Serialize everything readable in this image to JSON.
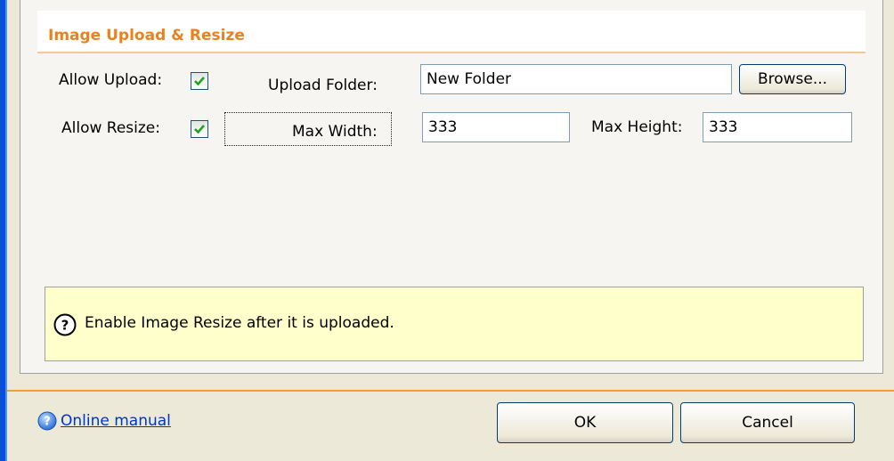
{
  "section": {
    "title": "Image Upload & Resize"
  },
  "upload": {
    "allow_label": "Allow Upload:",
    "allow_checked": true,
    "folder_label": "Upload Folder:",
    "folder_value": "New Folder",
    "browse_label": "Browse..."
  },
  "resize": {
    "allow_label": "Allow Resize:",
    "allow_checked": true,
    "max_width_label": "Max Width:",
    "max_width_value": "333",
    "max_height_label": "Max Height:",
    "max_height_value": "333"
  },
  "help": {
    "icon": "question-circle-icon",
    "text": "Enable Image Resize after it is uploaded."
  },
  "footer": {
    "manual_icon": "help-globe-icon",
    "manual_link": "Online manual",
    "ok_label": "OK",
    "cancel_label": "Cancel"
  },
  "colors": {
    "title_accent": "#e8821e",
    "help_background": "#ffffcc",
    "window_border": "#0a4fd8",
    "link": "#0033cc"
  }
}
